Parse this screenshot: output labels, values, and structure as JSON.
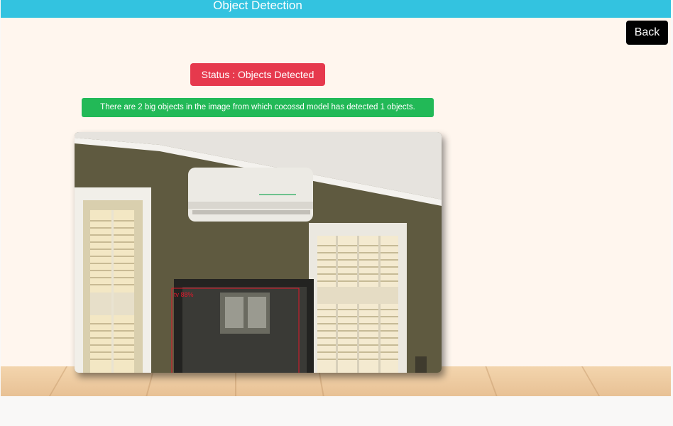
{
  "header": {
    "title": "Object Detection"
  },
  "toolbar": {
    "back_label": "Back"
  },
  "status": {
    "text": "Status : Objects Detected"
  },
  "result": {
    "message": "There are 2 big objects in the image from which cocossd model has detected 1 objects."
  },
  "detection": {
    "label": "tv 88%"
  },
  "colors": {
    "header": "#33c3e0",
    "status": "#e6394d",
    "alert": "#22b957",
    "box": "#e0182b",
    "background": "#fff6ee"
  }
}
